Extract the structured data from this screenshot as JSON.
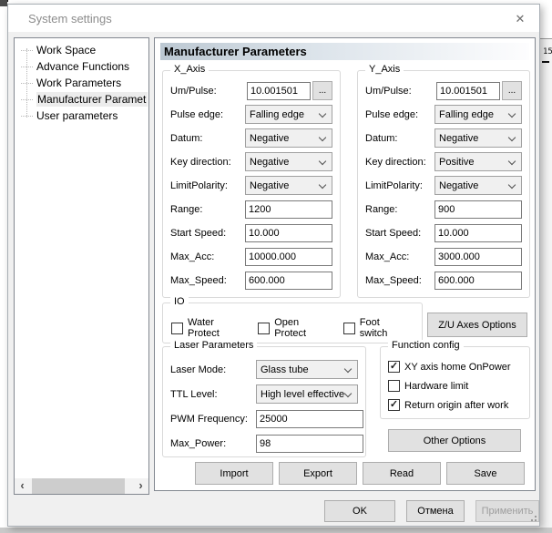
{
  "window": {
    "title": "System settings"
  },
  "icons": {
    "close": "✕",
    "check": "✓",
    "scroll_left": "‹",
    "scroll_right": "›"
  },
  "background": {
    "ruler_label": "15"
  },
  "sidebar": {
    "items": [
      {
        "label": "Work Space",
        "selected": false
      },
      {
        "label": "Advance Functions",
        "selected": false
      },
      {
        "label": "Work Parameters",
        "selected": false
      },
      {
        "label": "Manufacturer Paramet",
        "selected": true
      },
      {
        "label": "User parameters",
        "selected": false
      }
    ]
  },
  "panel": {
    "header": "Manufacturer Parameters",
    "ellipsis_button": "...",
    "x_axis": {
      "title": "X_Axis",
      "fields": [
        {
          "label": "Um/Pulse:",
          "type": "input-more",
          "value": "10.001501"
        },
        {
          "label": "Pulse edge:",
          "type": "combo",
          "value": "Falling edge"
        },
        {
          "label": "Datum:",
          "type": "combo",
          "value": "Negative"
        },
        {
          "label": "Key direction:",
          "type": "combo",
          "value": "Negative"
        },
        {
          "label": "LimitPolarity:",
          "type": "combo",
          "value": "Negative"
        },
        {
          "label": "Range:",
          "type": "input",
          "value": "1200"
        },
        {
          "label": "Start Speed:",
          "type": "input",
          "value": "10.000"
        },
        {
          "label": "Max_Acc:",
          "type": "input",
          "value": "10000.000"
        },
        {
          "label": "Max_Speed:",
          "type": "input",
          "value": "600.000"
        }
      ]
    },
    "y_axis": {
      "title": "Y_Axis",
      "fields": [
        {
          "label": "Um/Pulse:",
          "type": "input-more",
          "value": "10.001501"
        },
        {
          "label": "Pulse edge:",
          "type": "combo",
          "value": "Falling edge"
        },
        {
          "label": "Datum:",
          "type": "combo",
          "value": "Negative"
        },
        {
          "label": "Key direction:",
          "type": "combo",
          "value": "Positive"
        },
        {
          "label": "LimitPolarity:",
          "type": "combo",
          "value": "Negative"
        },
        {
          "label": "Range:",
          "type": "input",
          "value": "900"
        },
        {
          "label": "Start Speed:",
          "type": "input",
          "value": "10.000"
        },
        {
          "label": "Max_Acc:",
          "type": "input",
          "value": "3000.000"
        },
        {
          "label": "Max_Speed:",
          "type": "input",
          "value": "600.000"
        }
      ]
    },
    "io": {
      "title": "IO",
      "checkboxes": [
        {
          "label": "Water Protect",
          "checked": false
        },
        {
          "label": "Open Protect",
          "checked": false
        },
        {
          "label": "Foot switch",
          "checked": false
        }
      ]
    },
    "zu_axes_button": "Z/U Axes Options",
    "laser": {
      "title": "Laser Parameters",
      "fields": [
        {
          "label": "Laser Mode:",
          "type": "combo",
          "value": "Glass tube"
        },
        {
          "label": "TTL Level:",
          "type": "combo",
          "value": "High level effective"
        },
        {
          "label": "PWM Frequency:",
          "type": "input",
          "value": "25000"
        },
        {
          "label": "Max_Power:",
          "type": "input",
          "value": "98"
        }
      ]
    },
    "function_config": {
      "title": "Function config",
      "checkboxes": [
        {
          "label": "XY axis home OnPower",
          "checked": true
        },
        {
          "label": "Hardware limit",
          "checked": false
        },
        {
          "label": "Return origin after work",
          "checked": true
        }
      ]
    },
    "other_options_button": "Other Options",
    "action_buttons": {
      "import": "Import",
      "export": "Export",
      "read": "Read",
      "save": "Save"
    }
  },
  "footer": {
    "ok": "OK",
    "cancel": "Отмена",
    "apply": "Применить"
  }
}
